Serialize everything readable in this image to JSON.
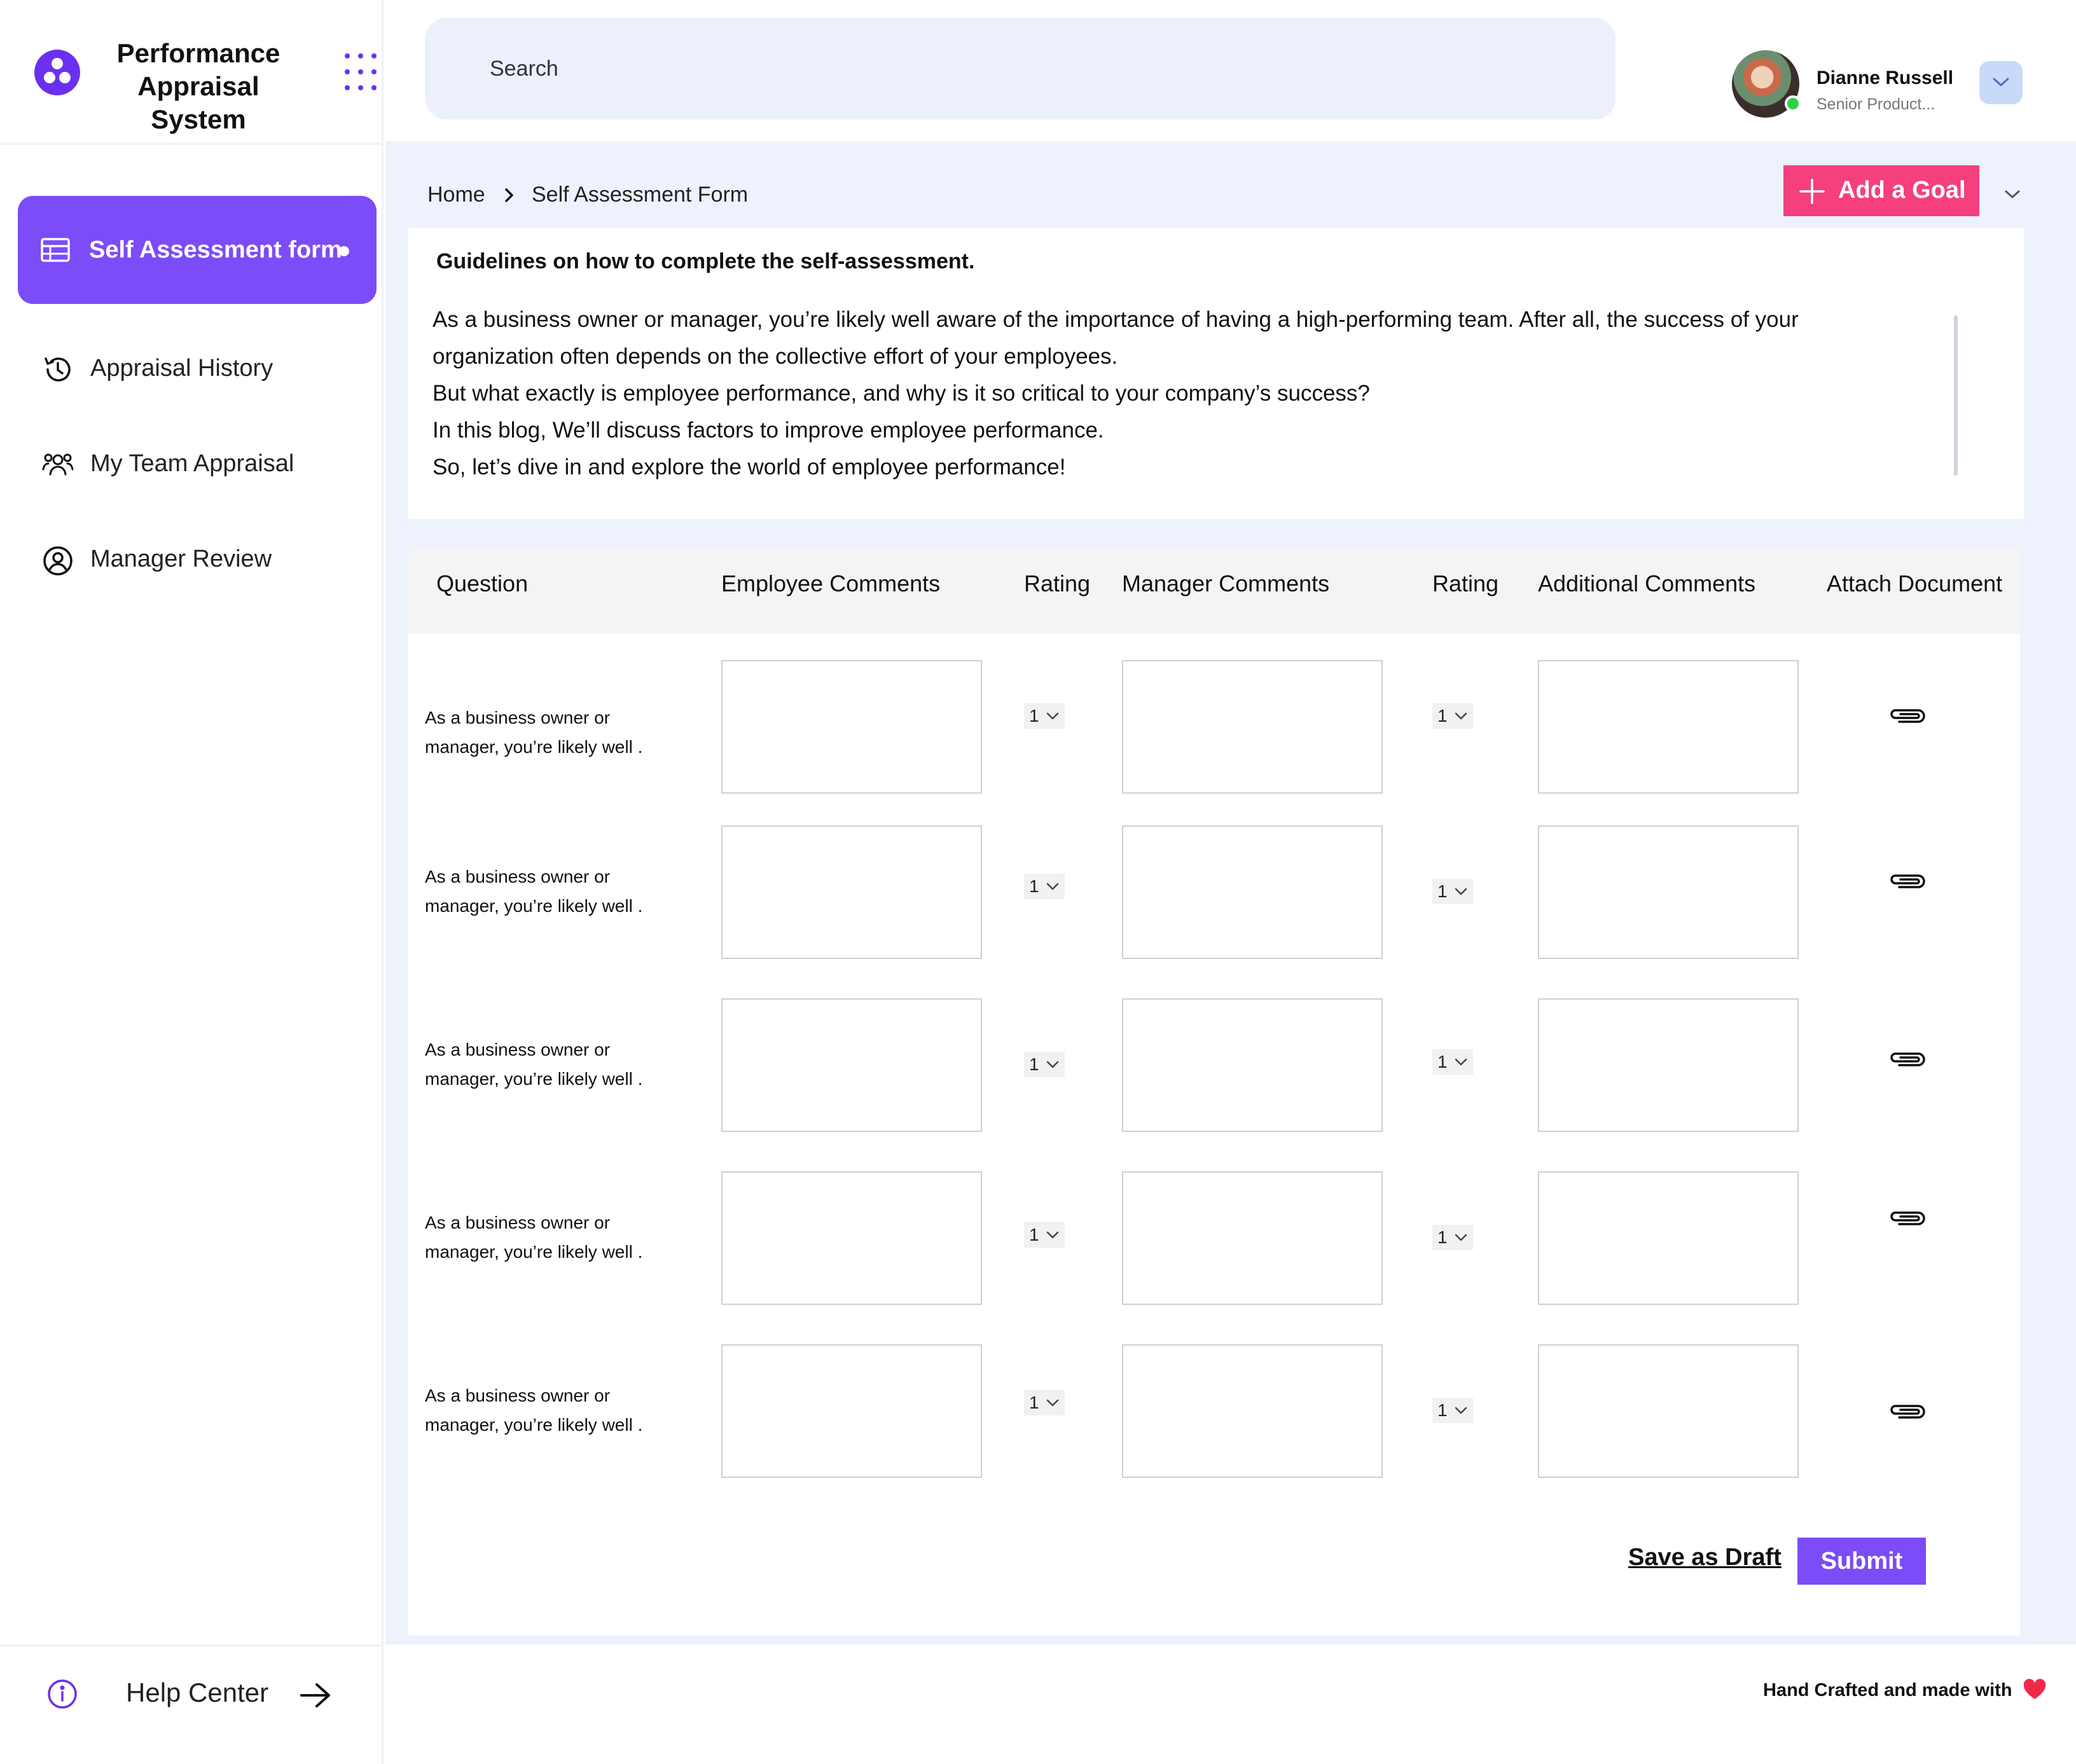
{
  "app": {
    "title_line1": "Performance",
    "title_line2": "Appraisal System",
    "accent_color": "#7b4cf7",
    "logo_icon": "logo-three-dots-icon",
    "apps_icon": "apps-grid-icon"
  },
  "sidebar": {
    "items": [
      {
        "label": "Self Assessment form",
        "icon": "table-icon",
        "active": true
      },
      {
        "label": "Appraisal History",
        "icon": "history-icon",
        "active": false
      },
      {
        "label": "My Team Appraisal",
        "icon": "team-icon",
        "active": false
      },
      {
        "label": "Manager Review",
        "icon": "user-circle-icon",
        "active": false
      }
    ],
    "help": {
      "label": "Help Center",
      "icon": "info-icon",
      "arrow_icon": "arrow-right-icon"
    }
  },
  "header": {
    "search_placeholder": "Search",
    "user": {
      "name": "Dianne Russell",
      "role": "Senior Product...",
      "status": "online",
      "menu_icon": "chevron-down-icon"
    }
  },
  "breadcrumb": {
    "home": "Home",
    "current": "Self Assessment Form"
  },
  "actions": {
    "add_goal": "Add a Goal",
    "add_goal_color": "#f53f7e",
    "save_draft": "Save as Draft",
    "submit": "Submit"
  },
  "guidelines": {
    "title": "Guidelines on how to complete the self-assessment.",
    "lines": [
      "As a business owner or manager, you’re likely well aware of the importance of having a high-performing team. After all, the success of your",
      "organization often depends on the collective effort of your employees.",
      "But what exactly is employee performance, and why is it so critical to your company’s success?",
      "In this blog, We’ll discuss factors to improve employee performance.",
      "So, let’s dive in and explore the world of employee performance!"
    ]
  },
  "table": {
    "headers": {
      "question": "Question",
      "employee_comments": "Employee Comments",
      "employee_rating": "Rating",
      "manager_comments": "Manager Comments",
      "manager_rating": "Rating",
      "additional_comments": "Additional Comments",
      "attach": "Attach Document"
    },
    "rows": [
      {
        "q1": "As a business owner or",
        "q2": "manager, you’re likely well .",
        "employee_rating": "1",
        "manager_rating": "1",
        "employee_comment": "",
        "manager_comment": "",
        "additional_comment": ""
      },
      {
        "q1": "As a business owner or",
        "q2": "manager, you’re likely well .",
        "employee_rating": "1",
        "manager_rating": "1",
        "employee_comment": "",
        "manager_comment": "",
        "additional_comment": ""
      },
      {
        "q1": "As a business owner or",
        "q2": "manager, you’re likely well .",
        "employee_rating": "1",
        "manager_rating": "1",
        "employee_comment": "",
        "manager_comment": "",
        "additional_comment": ""
      },
      {
        "q1": "As a business owner or",
        "q2": "manager, you’re likely well .",
        "employee_rating": "1",
        "manager_rating": "1",
        "employee_comment": "",
        "manager_comment": "",
        "additional_comment": ""
      },
      {
        "q1": "As a business owner or",
        "q2": "manager, you’re likely well .",
        "employee_rating": "1",
        "manager_rating": "1",
        "employee_comment": "",
        "manager_comment": "",
        "additional_comment": ""
      }
    ],
    "attach_icon": "paperclip-icon"
  },
  "footer": {
    "text": "Hand Crafted and made with",
    "icon": "heart-icon",
    "heart_color": "#f0284a"
  }
}
